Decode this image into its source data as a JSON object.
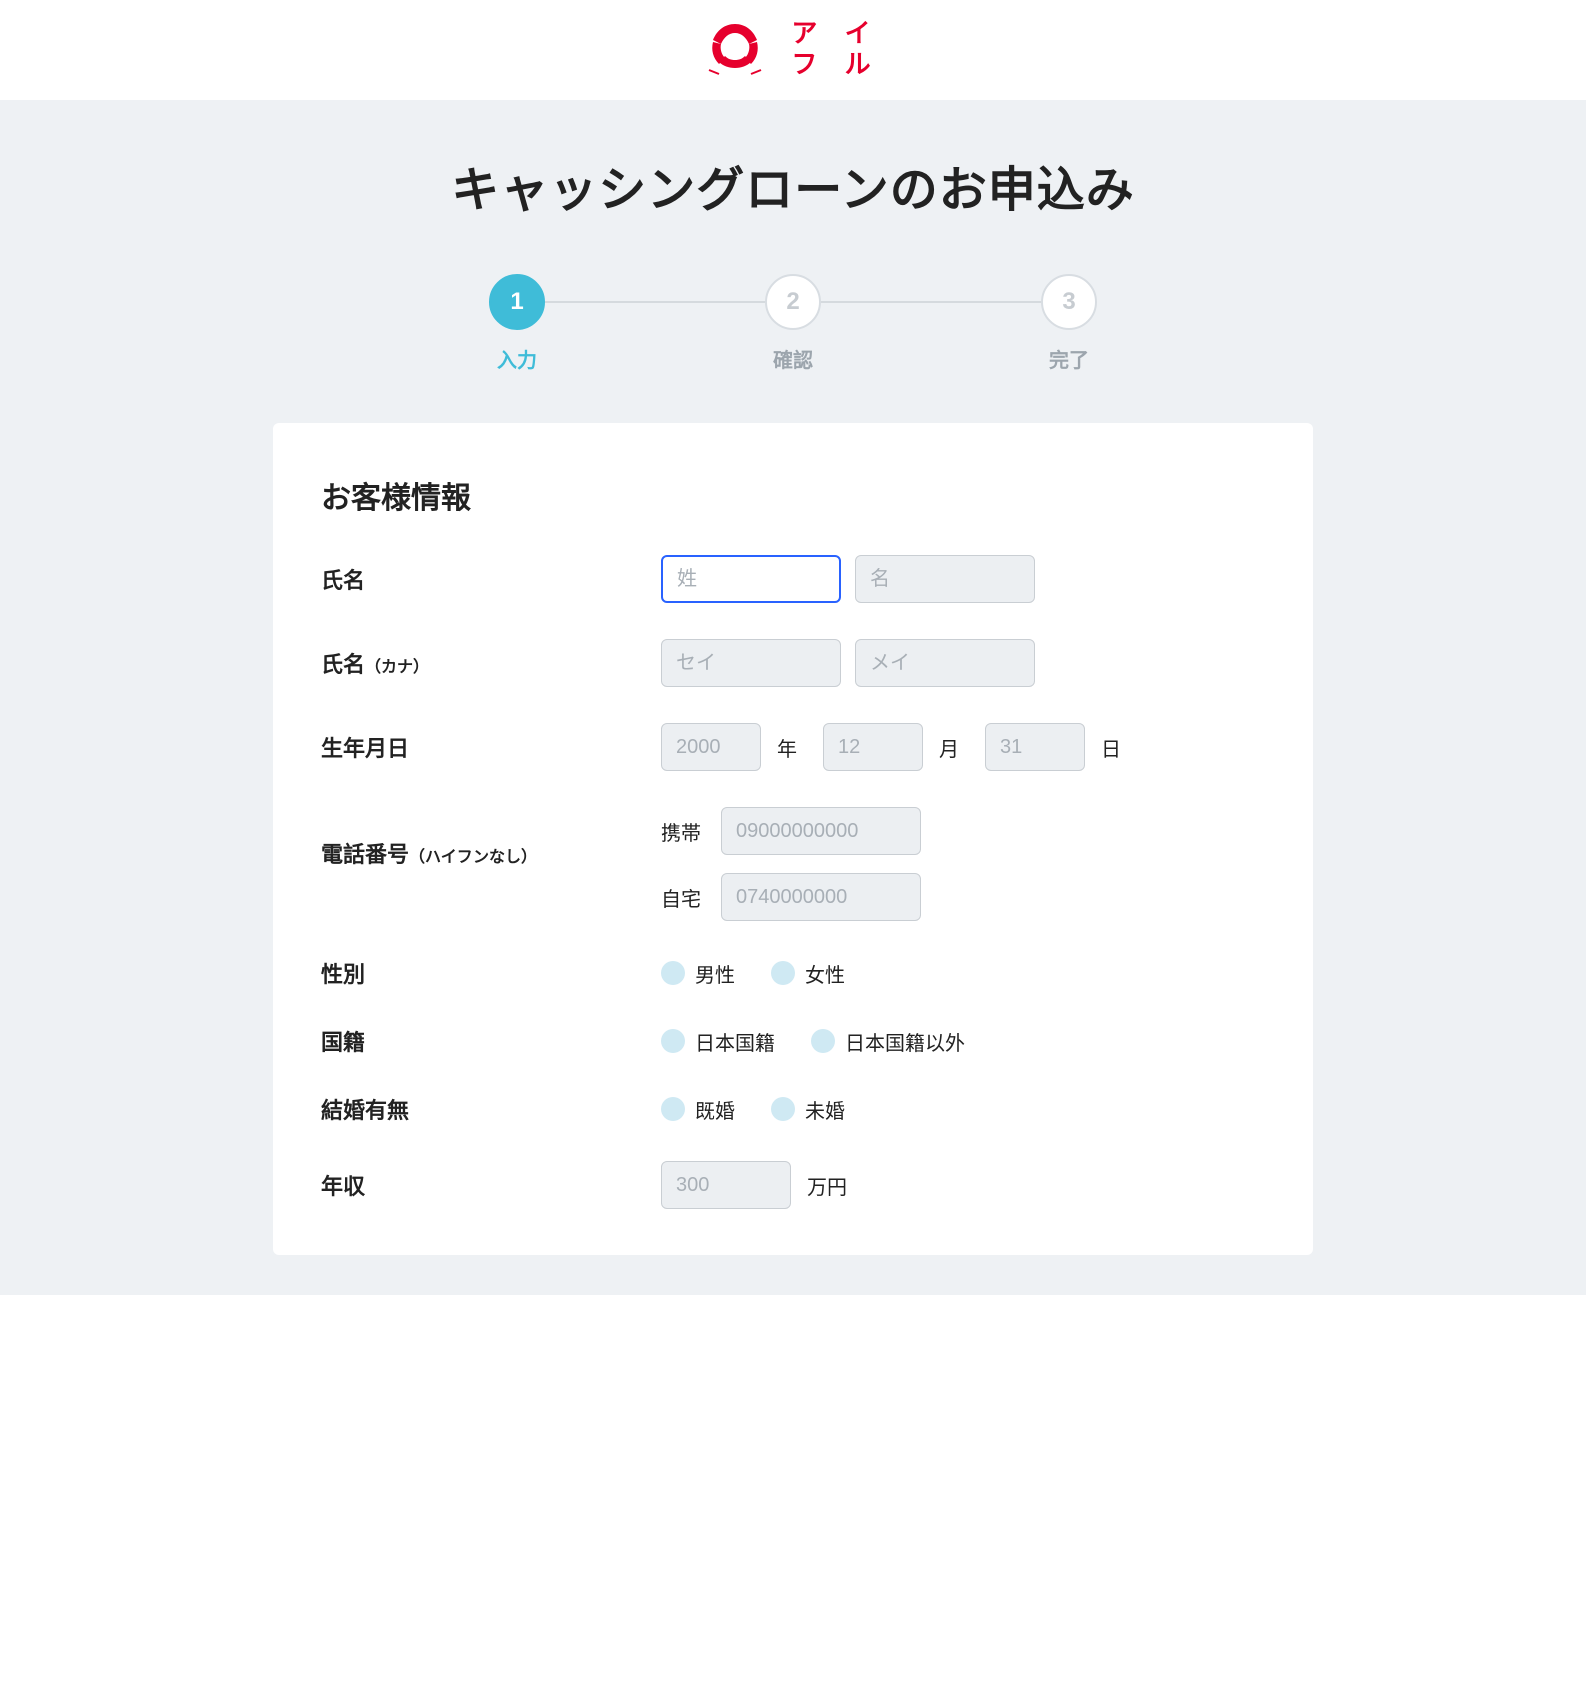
{
  "logo": {
    "text_line1": "ア イ",
    "text_line2": "フ ル"
  },
  "page_title": "キャッシングローンのお申込み",
  "steps": [
    {
      "num": "1",
      "label": "入力",
      "active": true
    },
    {
      "num": "2",
      "label": "確認",
      "active": false
    },
    {
      "num": "3",
      "label": "完了",
      "active": false
    }
  ],
  "section_title": "お客様情報",
  "fields": {
    "name": {
      "label": "氏名",
      "last_ph": "姓",
      "first_ph": "名"
    },
    "kana": {
      "label": "氏名",
      "sub": "（カナ）",
      "last_ph": "セイ",
      "first_ph": "メイ"
    },
    "birth": {
      "label": "生年月日",
      "year_ph": "2000",
      "y_unit": "年",
      "month_ph": "12",
      "m_unit": "月",
      "day_ph": "31",
      "d_unit": "日"
    },
    "phone": {
      "label": "電話番号",
      "sub": "（ハイフンなし）",
      "mobile_label": "携帯",
      "mobile_ph": "09000000000",
      "home_label": "自宅",
      "home_ph": "0740000000"
    },
    "gender": {
      "label": "性別",
      "opt1": "男性",
      "opt2": "女性"
    },
    "nationality": {
      "label": "国籍",
      "opt1": "日本国籍",
      "opt2": "日本国籍以外"
    },
    "marital": {
      "label": "結婚有無",
      "opt1": "既婚",
      "opt2": "未婚"
    },
    "income": {
      "label": "年収",
      "ph": "300",
      "unit": "万円"
    }
  }
}
